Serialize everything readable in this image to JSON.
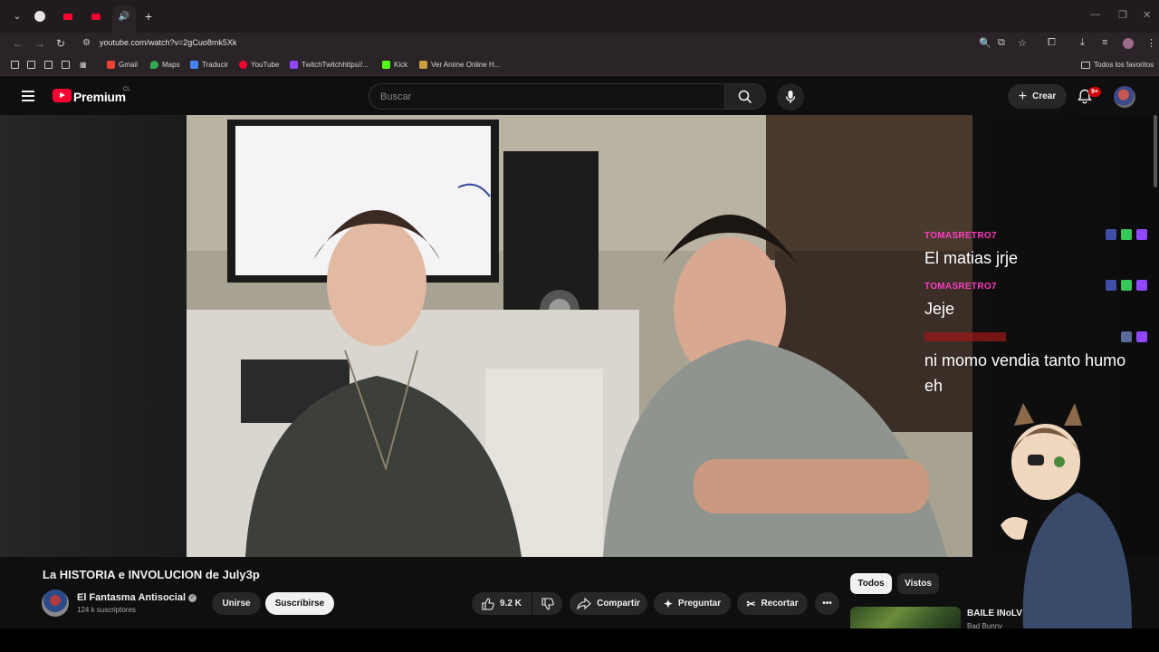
{
  "browser": {
    "url": "youtube.com/watch?v=2gCuo8mk5Xk",
    "bookmarks": [
      {
        "label": "Gmail",
        "color": "#ea4335"
      },
      {
        "label": "Maps",
        "color": "#34a853"
      },
      {
        "label": "Traducir",
        "color": "#4285f4"
      },
      {
        "label": "YouTube",
        "color": "#ff0033"
      },
      {
        "label": "TwitchTwitchhttps//...",
        "color": "#9146ff"
      },
      {
        "label": "Kick",
        "color": "#53fc18"
      },
      {
        "label": "Ver Anime Online H...",
        "color": "#c8a040"
      }
    ],
    "all_bookmarks": "Todos los favoritos"
  },
  "youtube": {
    "logo": "Premium",
    "logo_country": "CL",
    "search_placeholder": "Buscar",
    "create_label": "Crear",
    "notifications": "9+"
  },
  "chat": [
    {
      "user": "TOMASRETRO7",
      "message": "El matias jrje",
      "name_color": "#ff3cc0"
    },
    {
      "user": "TOMASRETRO7",
      "message": "Jeje",
      "name_color": "#ff3cc0"
    },
    {
      "user": "",
      "message": "ni momo vendia tanto humo eh",
      "name_color": "#e01818"
    }
  ],
  "video": {
    "title": "La HISTORIA e INVOLUCION de July3p",
    "channel": "El Fantasma Antisocial",
    "subscribers": "124 k suscriptores",
    "join_label": "Unirse",
    "subscribe_label": "Suscribirse",
    "likes": "9.2 K",
    "share_label": "Compartir",
    "ask_label": "Preguntar",
    "clip_label": "Recortar"
  },
  "sidebar": {
    "chips": [
      "Todos",
      "Vistos"
    ],
    "recommended_title": "BAILE INoLV",
    "recommended_channel": "Bad Bunny"
  }
}
